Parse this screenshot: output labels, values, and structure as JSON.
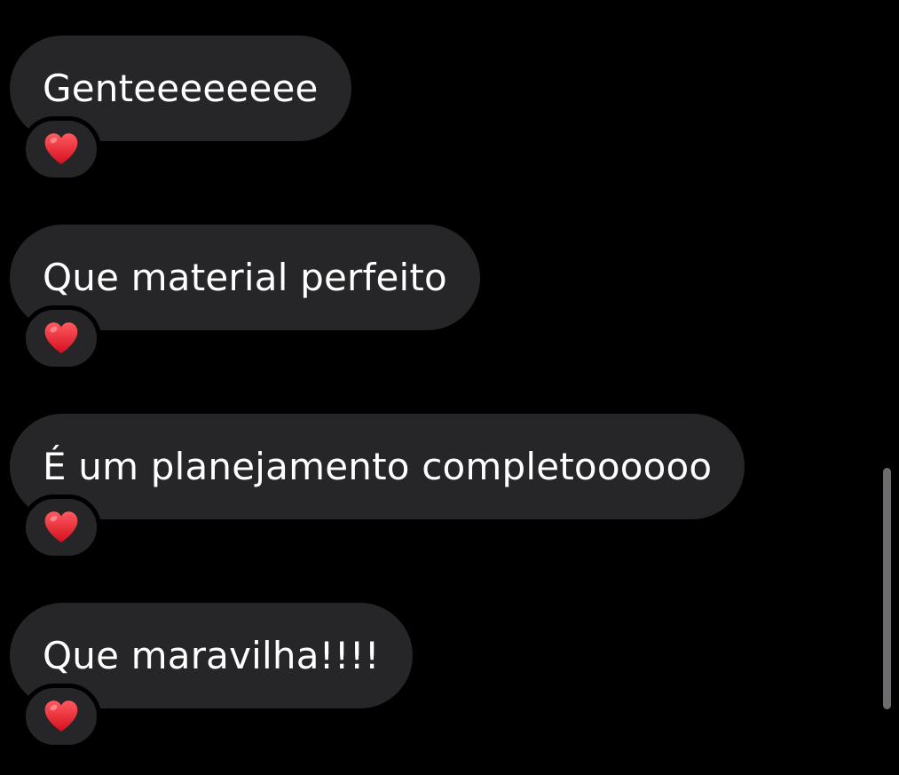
{
  "messages": [
    {
      "text": "Genteeeeeeee",
      "reaction": "red-heart"
    },
    {
      "text": "Que material perfeito",
      "reaction": "red-heart"
    },
    {
      "text": "É um planejamento completoooooo",
      "reaction": "red-heart"
    },
    {
      "text": "Que maravilha!!!!",
      "reaction": "red-heart"
    }
  ],
  "colors": {
    "background": "#000000",
    "bubble": "#262628",
    "text": "#ffffff",
    "heart": "#e8202e",
    "scrollbar": "#6d6d70"
  }
}
